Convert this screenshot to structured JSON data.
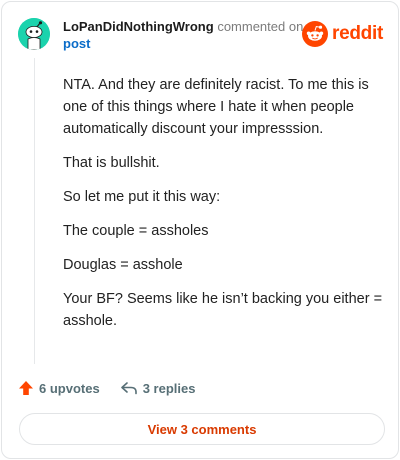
{
  "header": {
    "author": "LoPanDidNothingWrong",
    "commented_on": "commented on",
    "post_link": "post"
  },
  "brand": {
    "name": "reddit",
    "color": "#ff4500"
  },
  "comment": {
    "paragraphs": [
      "NTA. And they are definitely racist. To me this is one of this things where I hate it when people automatically discount your impresssion.",
      "That is bullshit.",
      "So let me put it this way:",
      "The couple = assholes",
      "Douglas = asshole",
      "Your BF? Seems like he isn’t backing you either = asshole."
    ]
  },
  "actions": {
    "upvotes_label": "6 upvotes",
    "replies_label": "3 replies",
    "upvote_icon": "upvote-arrow-icon",
    "reply_icon": "reply-arrow-icon",
    "upvote_color": "#ff4500"
  },
  "footer": {
    "view_comments_label": "View 3 comments"
  },
  "avatar": {
    "color": "#1bd3ad",
    "icon": "snoo-avatar-icon"
  }
}
